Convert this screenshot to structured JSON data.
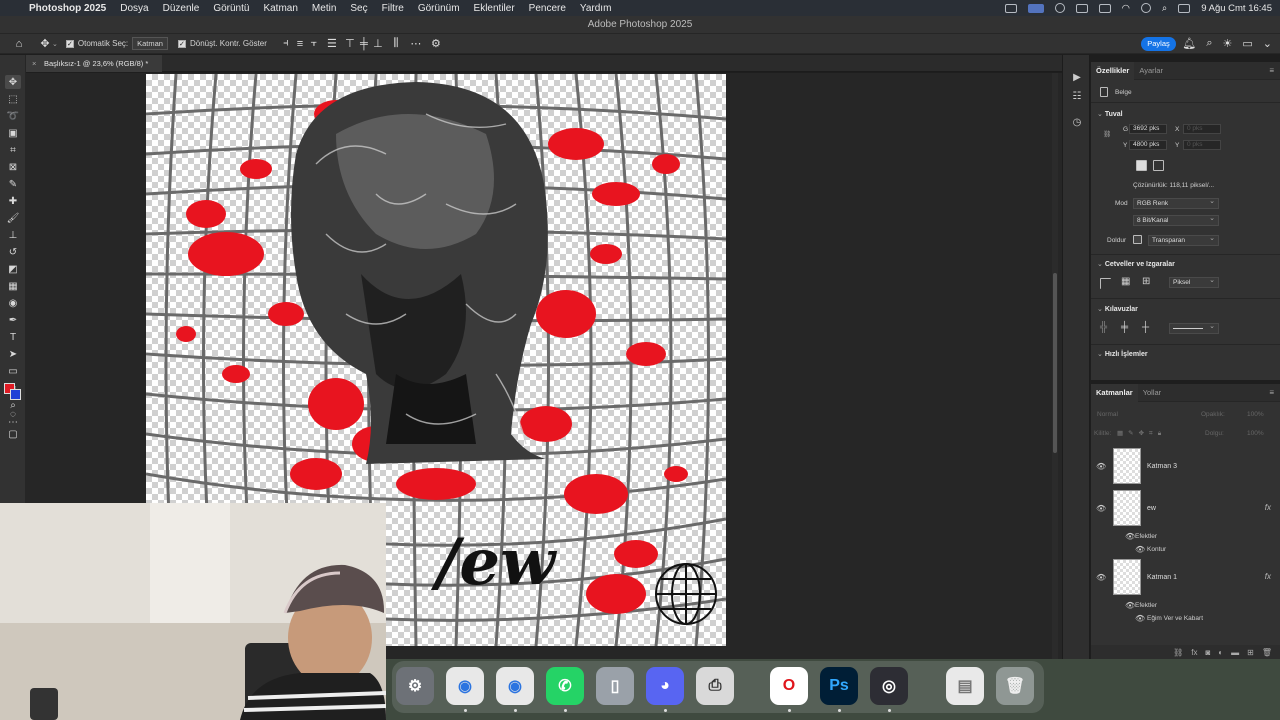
{
  "menubar": {
    "app_name": "Photoshop 2025",
    "items": [
      "Dosya",
      "Düzenle",
      "Görüntü",
      "Katman",
      "Metin",
      "Seç",
      "Filtre",
      "Görünüm",
      "Eklentiler",
      "Pencere",
      "Yardım"
    ],
    "datetime": "9 Ağu Cmt  16:45"
  },
  "window": {
    "title": "Adobe Photoshop 2025"
  },
  "options_bar": {
    "auto_select_label": "Otomatik Seç:",
    "auto_select_value": "Katman",
    "transform_label": "Dönüşt. Kontr. Göster",
    "share_label": "Paylaş"
  },
  "document": {
    "tab_title": "Başlıksız-1 @ 23,6% (RGB/8) *"
  },
  "canvas": {
    "text_art": "/ew"
  },
  "colors": {
    "foreground": "#e01b24",
    "background": "#1f3fd6",
    "accent": "#1473e6"
  },
  "properties": {
    "tabs": [
      "Özellikler",
      "Ayarlar"
    ],
    "doc_label": "Belge",
    "canvas_section": "Tuval",
    "w_label": "G",
    "w_value": "3692 pks",
    "h_label": "Y",
    "h_value": "4800 pks",
    "x_label": "X",
    "x_value": "0 pks",
    "y_label": "Y",
    "y_value": "0 pks",
    "resolution": "Çözünürlük: 118,11 piksel/...",
    "mode_label": "Mod",
    "mode_value": "RGB Renk",
    "depth_value": "8 Bit/Kanal",
    "fill_label": "Doldur",
    "fill_value": "Transparan",
    "rulers_section": "Cetveller ve Izgaralar",
    "ruler_unit": "Piksel",
    "guides_section": "Kılavuzlar",
    "quick_actions": "Hızlı İşlemler"
  },
  "layers": {
    "tabs": [
      "Katmanlar",
      "Yollar"
    ],
    "blend_mode": "Normal",
    "opacity_label": "Opaklık:",
    "opacity_value": "100%",
    "lock_label": "Kilitle:",
    "fill_label": "Dolgu:",
    "fill_value": "100%",
    "items": [
      {
        "name": "Katman 3"
      },
      {
        "name": "ew",
        "fx": "fx",
        "effects_label": "Efektler",
        "effects": [
          "Kontur"
        ]
      },
      {
        "name": "Katman 1",
        "fx": "fx",
        "effects_label": "Efektler",
        "effects": [
          "Eğim Ver ve Kabart"
        ]
      }
    ]
  },
  "dock": {
    "apps": [
      "System Settings",
      "Chrome",
      "Chrome",
      "WhatsApp",
      "iPhone Mirroring",
      "Discord",
      "Printer",
      "Opera",
      "Photoshop",
      "OBS",
      "Preview",
      "Trash"
    ],
    "ps_label": "Ps"
  }
}
